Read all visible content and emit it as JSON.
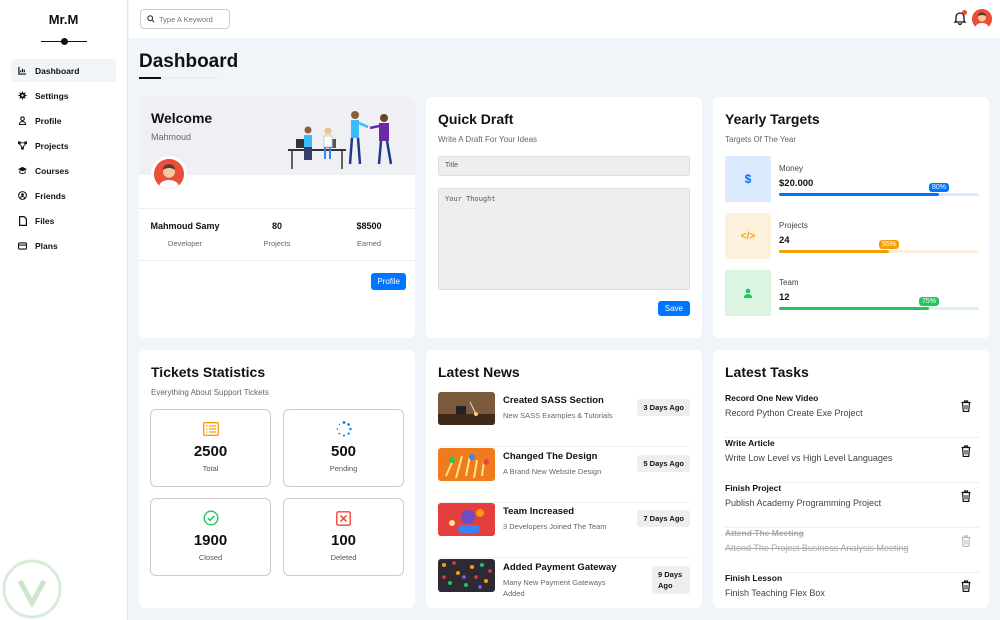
{
  "brand": "Mr.M",
  "sidebar": {
    "items": [
      {
        "label": "Dashboard",
        "icon": "chart-icon"
      },
      {
        "label": "Settings",
        "icon": "gear-icon"
      },
      {
        "label": "Profile",
        "icon": "user-icon"
      },
      {
        "label": "Projects",
        "icon": "diagram-icon"
      },
      {
        "label": "Courses",
        "icon": "graduation-cap-icon"
      },
      {
        "label": "Friends",
        "icon": "circle-user-icon"
      },
      {
        "label": "Files",
        "icon": "file-icon"
      },
      {
        "label": "Plans",
        "icon": "credit-card-icon"
      }
    ]
  },
  "search": {
    "placeholder": "Type A Keyword"
  },
  "page_title": "Dashboard",
  "welcome": {
    "title": "Welcome",
    "name": "Mahmoud",
    "full_name": "Mahmoud Samy",
    "role": "Developer",
    "projects": "80",
    "projects_label": "Projects",
    "earned": "$8500",
    "earned_label": "Earned",
    "button": "Profile"
  },
  "draft": {
    "title": "Quick Draft",
    "subtitle": "Write A Draft For Your Ideas",
    "title_placeholder": "Title",
    "body_placeholder": "Your Thought",
    "button": "Save"
  },
  "targets": {
    "title": "Yearly Targets",
    "subtitle": "Targets Of The Year",
    "items": [
      {
        "name": "Money",
        "value": "$20.000",
        "percent": "80%",
        "fraction": 0.8,
        "color": "#0075ff",
        "bg": "#dbeafe",
        "icon": "$"
      },
      {
        "name": "Projects",
        "value": "24",
        "percent": "55%",
        "fraction": 0.55,
        "color": "#f59e0b",
        "bg": "#fdf1dc",
        "icon": "</>"
      },
      {
        "name": "Team",
        "value": "12",
        "percent": "75%",
        "fraction": 0.75,
        "color": "#22c55e",
        "bg": "#dcf5e3",
        "icon": "user"
      }
    ]
  },
  "tickets": {
    "title": "Tickets Statistics",
    "subtitle": "Everything About Support Tickets",
    "items": [
      {
        "value": "2500",
        "label": "Total",
        "color": "#f59e0b",
        "icon": "list-icon"
      },
      {
        "value": "500",
        "label": "Pending",
        "color": "#0075ff",
        "icon": "spinner-icon"
      },
      {
        "value": "1900",
        "label": "Closed",
        "color": "#22c55e",
        "icon": "check-circle-icon"
      },
      {
        "value": "100",
        "label": "Deleted",
        "color": "#f44336",
        "icon": "x-square-icon"
      }
    ]
  },
  "news": {
    "title": "Latest News",
    "items": [
      {
        "title": "Created SASS Section",
        "desc": "New SASS Examples & Tutorials",
        "ago": "3 Days Ago"
      },
      {
        "title": "Changed The Design",
        "desc": "A Brand New Website Design",
        "ago": "5 Days Ago"
      },
      {
        "title": "Team Increased",
        "desc": "3 Developers Joined The Team",
        "ago": "7 Days Ago"
      },
      {
        "title": "Added Payment Gateway",
        "desc": "Many New Payment Gateways Added",
        "ago": "9 Days Ago"
      }
    ]
  },
  "tasks": {
    "title": "Latest Tasks",
    "items": [
      {
        "title": "Record One New Video",
        "desc": "Record Python Create Exe Project",
        "done": false
      },
      {
        "title": "Write Article",
        "desc": "Write Low Level vs High Level Languages",
        "done": false
      },
      {
        "title": "Finish Project",
        "desc": "Publish Academy Programming Project",
        "done": false
      },
      {
        "title": "Attend The Meeting",
        "desc": "Attend The Project Business Analysis Meeting",
        "done": true
      },
      {
        "title": "Finish Lesson",
        "desc": "Finish Teaching Flex Box",
        "done": false
      }
    ]
  },
  "colors": {
    "accent": "#0075ff",
    "background": "#f1f5f9"
  }
}
